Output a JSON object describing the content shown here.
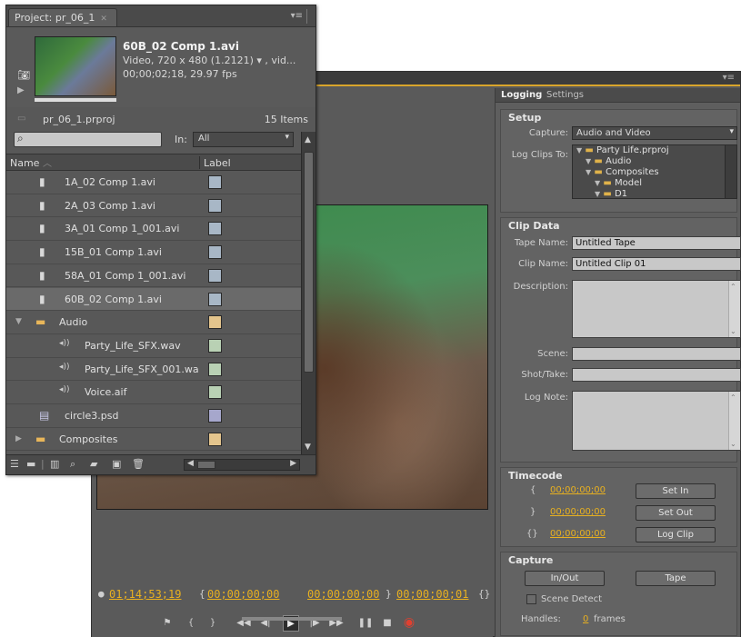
{
  "project_panel": {
    "tab_title": "Project: pr_06_1",
    "clip": {
      "name": "60B_02 Comp 1.avi",
      "line1": "Video, 720 x 480 (1.2121) ▾ , vid...",
      "line2": "00;00;02;18, 29.97 fps"
    },
    "project_file": "pr_06_1.prproj",
    "item_count": "15 Items",
    "filter_label": "In:",
    "filter_value": "All",
    "columns": {
      "name": "Name",
      "label": "Label"
    },
    "items": [
      {
        "name": "1A_02 Comp 1.avi",
        "type": "video",
        "label_color": "#a8b7c6"
      },
      {
        "name": "2A_03 Comp 1.avi",
        "type": "video",
        "label_color": "#a8b7c6"
      },
      {
        "name": "3A_01 Comp 1_001.avi",
        "type": "video",
        "label_color": "#a8b7c6"
      },
      {
        "name": "15B_01 Comp 1.avi",
        "type": "video",
        "label_color": "#a8b7c6"
      },
      {
        "name": "58A_01 Comp 1_001.avi",
        "type": "video",
        "label_color": "#a8b7c6"
      },
      {
        "name": "60B_02 Comp 1.avi",
        "type": "video",
        "label_color": "#a8b7c6",
        "selected": true
      },
      {
        "name": "Audio",
        "type": "bin-open",
        "label_color": "#e4c58d"
      },
      {
        "name": "Party_Life_SFX.wav",
        "type": "audio",
        "label_color": "#b9d1b4"
      },
      {
        "name": "Party_Life_SFX_001.wa",
        "type": "audio",
        "label_color": "#b9d1b4"
      },
      {
        "name": "Voice.aif",
        "type": "audio",
        "label_color": "#b9d1b4"
      },
      {
        "name": "circle3.psd",
        "type": "image",
        "label_color": "#a6a7cc"
      },
      {
        "name": "Composites",
        "type": "bin-closed",
        "label_color": "#e4c58d"
      }
    ]
  },
  "logging_panel": {
    "tabs": [
      "Logging",
      "Settings"
    ],
    "setup": {
      "title": "Setup",
      "capture_label": "Capture:",
      "capture_value": "Audio and Video",
      "log_clips_label": "Log Clips To:",
      "tree": [
        "Party Life.prproj",
        "Audio",
        "Composites",
        "Model",
        "D1"
      ]
    },
    "clip_data": {
      "title": "Clip Data",
      "tape_name_label": "Tape Name:",
      "tape_name_value": "Untitled Tape",
      "clip_name_label": "Clip Name:",
      "clip_name_value": "Untitled Clip 01",
      "description_label": "Description:",
      "scene_label": "Scene:",
      "shot_label": "Shot/Take:",
      "log_note_label": "Log Note:"
    },
    "timecode": {
      "title": "Timecode",
      "in_value": "00;00;00;00",
      "out_value": "00;00;00;00",
      "dur_value": "00;00;00;00",
      "set_in": "Set In",
      "set_out": "Set Out",
      "log_clip": "Log Clip"
    },
    "capture": {
      "title": "Capture",
      "in_out": "In/Out",
      "tape": "Tape",
      "scene_detect": "Scene Detect",
      "handles_label": "Handles:",
      "handles_value": "0",
      "handles_unit": "frames"
    }
  },
  "monitor": {
    "current_tc": "01;14;53;19",
    "in_tc": "00;00;00;00",
    "out_tc": "00;00;00;00",
    "dur_tc": "00;00;00;01"
  },
  "colors": {
    "accent": "#e8b020",
    "panel_bg": "#585858"
  }
}
